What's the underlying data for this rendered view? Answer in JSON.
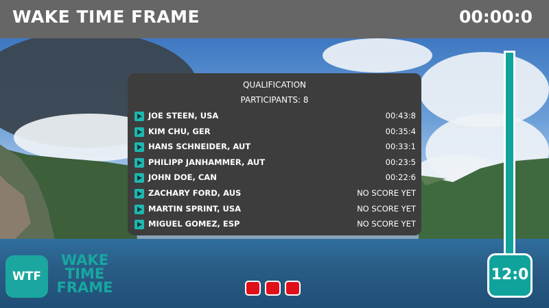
{
  "header": {
    "title": "WAKE TIME FRAME",
    "timer": "00:00:0"
  },
  "panel": {
    "title": "QUALIFICATION",
    "participants_label": "PARTICIPANTS: 8",
    "rows": [
      {
        "name": "JOE STEEN, USA",
        "score": "00:43:8"
      },
      {
        "name": "KIM CHU, GER",
        "score": "00:35:4"
      },
      {
        "name": "HANS SCHNEIDER, AUT",
        "score": "00:33:1"
      },
      {
        "name": "PHILIPP JANHAMMER, AUT",
        "score": "00:23:5"
      },
      {
        "name": "JOHN DOE, CAN",
        "score": "00:22:6"
      },
      {
        "name": "ZACHARY FORD, AUS",
        "score": "NO SCORE YET"
      },
      {
        "name": "MARTIN SPRINT, USA",
        "score": "NO SCORE YET"
      },
      {
        "name": "MIGUEL GOMEZ, ESP",
        "score": "NO SCORE YET"
      }
    ]
  },
  "side_timer": {
    "value": "12:0"
  },
  "logo": {
    "badge": "WTF",
    "line1": "WAKE",
    "line2": "TIME",
    "line3": "FRAME"
  },
  "attempts": {
    "count": 3,
    "color": "#e0101a"
  },
  "colors": {
    "accent": "#1ba79f",
    "header_bg": "#666666",
    "panel_bg": "#3d3d3d"
  }
}
